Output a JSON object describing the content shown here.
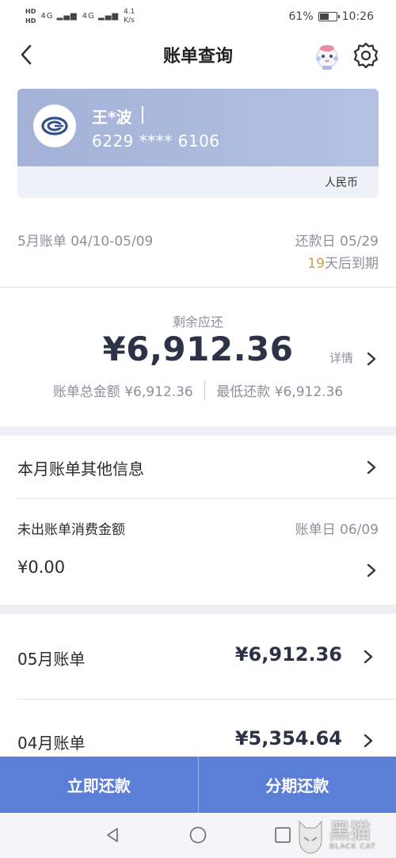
{
  "status_bar": {
    "hd1": "HD",
    "hd2": "HD",
    "signal1": "4G",
    "signal2": "4G",
    "speed_value": "4.1",
    "speed_unit": "K/s",
    "battery": "61%",
    "battery_level": 0.61,
    "time": "10:26"
  },
  "nav": {
    "title": "账单查询"
  },
  "card": {
    "holder": "王*波",
    "number": "6229 **** 6106",
    "currency": "人民币"
  },
  "bill_period": {
    "period": "5月账单 04/10-05/09",
    "due_date": "还款日 05/29",
    "days_value": "19",
    "days_suffix": "天后到期"
  },
  "summary": {
    "remaining_label": "剩余应还",
    "remaining_amount": "¥6,912.36",
    "detail_label": "详情",
    "total_label": "账单总金额 ¥6,912.36",
    "minimum_label": "最低还款 ¥6,912.36"
  },
  "other_info": {
    "label": "本月账单其他信息"
  },
  "unbilled": {
    "label": "未出账单消费金额",
    "bill_date": "账单日 06/09",
    "amount": "¥0.00"
  },
  "bills": [
    {
      "month": "05月账单",
      "amount": "¥6,912.36"
    },
    {
      "month": "04月账单",
      "amount": "¥5,354.64"
    }
  ],
  "actions": {
    "repay_now": "立即还款",
    "installment": "分期还款"
  },
  "watermark": {
    "cn": "黑猫",
    "en": "BLACK CAT"
  },
  "colors": {
    "primary": "#5b7fd6",
    "card_gradient": "#a3b2d8",
    "accent_days": "#c4a050",
    "amount_text": "#2d3346"
  }
}
